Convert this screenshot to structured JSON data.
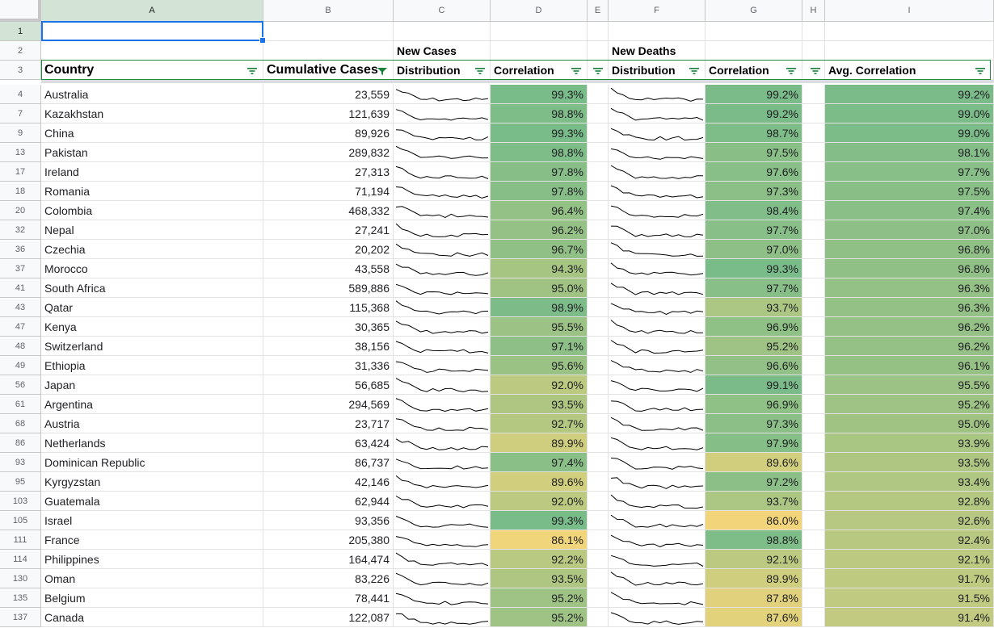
{
  "columns": [
    "A",
    "B",
    "C",
    "D",
    "E",
    "F",
    "G",
    "H",
    "I"
  ],
  "header_rows": [
    {
      "row": "1"
    },
    {
      "row": "2",
      "new_cases_label": "New Cases",
      "new_deaths_label": "New Deaths"
    },
    {
      "row": "3",
      "country": "Country",
      "cumulative_cases": "Cumulative Cases",
      "nc_distribution": "Distribution",
      "nc_correlation": "Correlation",
      "nd_distribution": "Distribution",
      "nd_correlation": "Correlation",
      "avg_correlation": "Avg. Correlation"
    }
  ],
  "rows": [
    {
      "row": "4",
      "country": "Australia",
      "cases": "23,559",
      "nc_corr": "99.3%",
      "nd_corr": "99.2%",
      "avg": "99.2%"
    },
    {
      "row": "7",
      "country": "Kazakhstan",
      "cases": "121,639",
      "nc_corr": "98.8%",
      "nd_corr": "99.2%",
      "avg": "99.0%"
    },
    {
      "row": "9",
      "country": "China",
      "cases": "89,926",
      "nc_corr": "99.3%",
      "nd_corr": "98.7%",
      "avg": "99.0%"
    },
    {
      "row": "13",
      "country": "Pakistan",
      "cases": "289,832",
      "nc_corr": "98.8%",
      "nd_corr": "97.5%",
      "avg": "98.1%"
    },
    {
      "row": "17",
      "country": "Ireland",
      "cases": "27,313",
      "nc_corr": "97.8%",
      "nd_corr": "97.6%",
      "avg": "97.7%"
    },
    {
      "row": "18",
      "country": "Romania",
      "cases": "71,194",
      "nc_corr": "97.8%",
      "nd_corr": "97.3%",
      "avg": "97.5%"
    },
    {
      "row": "20",
      "country": "Colombia",
      "cases": "468,332",
      "nc_corr": "96.4%",
      "nd_corr": "98.4%",
      "avg": "97.4%"
    },
    {
      "row": "32",
      "country": "Nepal",
      "cases": "27,241",
      "nc_corr": "96.2%",
      "nd_corr": "97.7%",
      "avg": "97.0%"
    },
    {
      "row": "36",
      "country": "Czechia",
      "cases": "20,202",
      "nc_corr": "96.7%",
      "nd_corr": "97.0%",
      "avg": "96.8%"
    },
    {
      "row": "37",
      "country": "Morocco",
      "cases": "43,558",
      "nc_corr": "94.3%",
      "nd_corr": "99.3%",
      "avg": "96.8%"
    },
    {
      "row": "41",
      "country": "South Africa",
      "cases": "589,886",
      "nc_corr": "95.0%",
      "nd_corr": "97.7%",
      "avg": "96.3%"
    },
    {
      "row": "43",
      "country": "Qatar",
      "cases": "115,368",
      "nc_corr": "98.9%",
      "nd_corr": "93.7%",
      "avg": "96.3%"
    },
    {
      "row": "47",
      "country": "Kenya",
      "cases": "30,365",
      "nc_corr": "95.5%",
      "nd_corr": "96.9%",
      "avg": "96.2%"
    },
    {
      "row": "48",
      "country": "Switzerland",
      "cases": "38,156",
      "nc_corr": "97.1%",
      "nd_corr": "95.2%",
      "avg": "96.2%"
    },
    {
      "row": "49",
      "country": "Ethiopia",
      "cases": "31,336",
      "nc_corr": "95.6%",
      "nd_corr": "96.6%",
      "avg": "96.1%"
    },
    {
      "row": "56",
      "country": "Japan",
      "cases": "56,685",
      "nc_corr": "92.0%",
      "nd_corr": "99.1%",
      "avg": "95.5%"
    },
    {
      "row": "61",
      "country": "Argentina",
      "cases": "294,569",
      "nc_corr": "93.5%",
      "nd_corr": "96.9%",
      "avg": "95.2%"
    },
    {
      "row": "68",
      "country": "Austria",
      "cases": "23,717",
      "nc_corr": "92.7%",
      "nd_corr": "97.3%",
      "avg": "95.0%"
    },
    {
      "row": "86",
      "country": "Netherlands",
      "cases": "63,424",
      "nc_corr": "89.9%",
      "nd_corr": "97.9%",
      "avg": "93.9%"
    },
    {
      "row": "93",
      "country": "Dominican Republic",
      "cases": "86,737",
      "nc_corr": "97.4%",
      "nd_corr": "89.6%",
      "avg": "93.5%"
    },
    {
      "row": "95",
      "country": "Kyrgyzstan",
      "cases": "42,146",
      "nc_corr": "89.6%",
      "nd_corr": "97.2%",
      "avg": "93.4%"
    },
    {
      "row": "103",
      "country": "Guatemala",
      "cases": "62,944",
      "nc_corr": "92.0%",
      "nd_corr": "93.7%",
      "avg": "92.8%"
    },
    {
      "row": "105",
      "country": "Israel",
      "cases": "93,356",
      "nc_corr": "99.3%",
      "nd_corr": "86.0%",
      "avg": "92.6%"
    },
    {
      "row": "111",
      "country": "France",
      "cases": "205,380",
      "nc_corr": "86.1%",
      "nd_corr": "98.8%",
      "avg": "92.4%"
    },
    {
      "row": "114",
      "country": "Philippines",
      "cases": "164,474",
      "nc_corr": "92.2%",
      "nd_corr": "92.1%",
      "avg": "92.1%"
    },
    {
      "row": "130",
      "country": "Oman",
      "cases": "83,226",
      "nc_corr": "93.5%",
      "nd_corr": "89.9%",
      "avg": "91.7%"
    },
    {
      "row": "135",
      "country": "Belgium",
      "cases": "78,441",
      "nc_corr": "95.2%",
      "nd_corr": "87.8%",
      "avg": "91.5%"
    },
    {
      "row": "137",
      "country": "Canada",
      "cases": "122,087",
      "nc_corr": "95.2%",
      "nd_corr": "87.6%",
      "avg": "91.4%"
    }
  ],
  "colors": {
    "scale_low": "#f2d57a",
    "scale_high": "#79bb89",
    "selection": "#1a73e8",
    "header_selected": "#d3e3d6",
    "filter_icon": "#188038"
  },
  "filter_active_column": "B"
}
